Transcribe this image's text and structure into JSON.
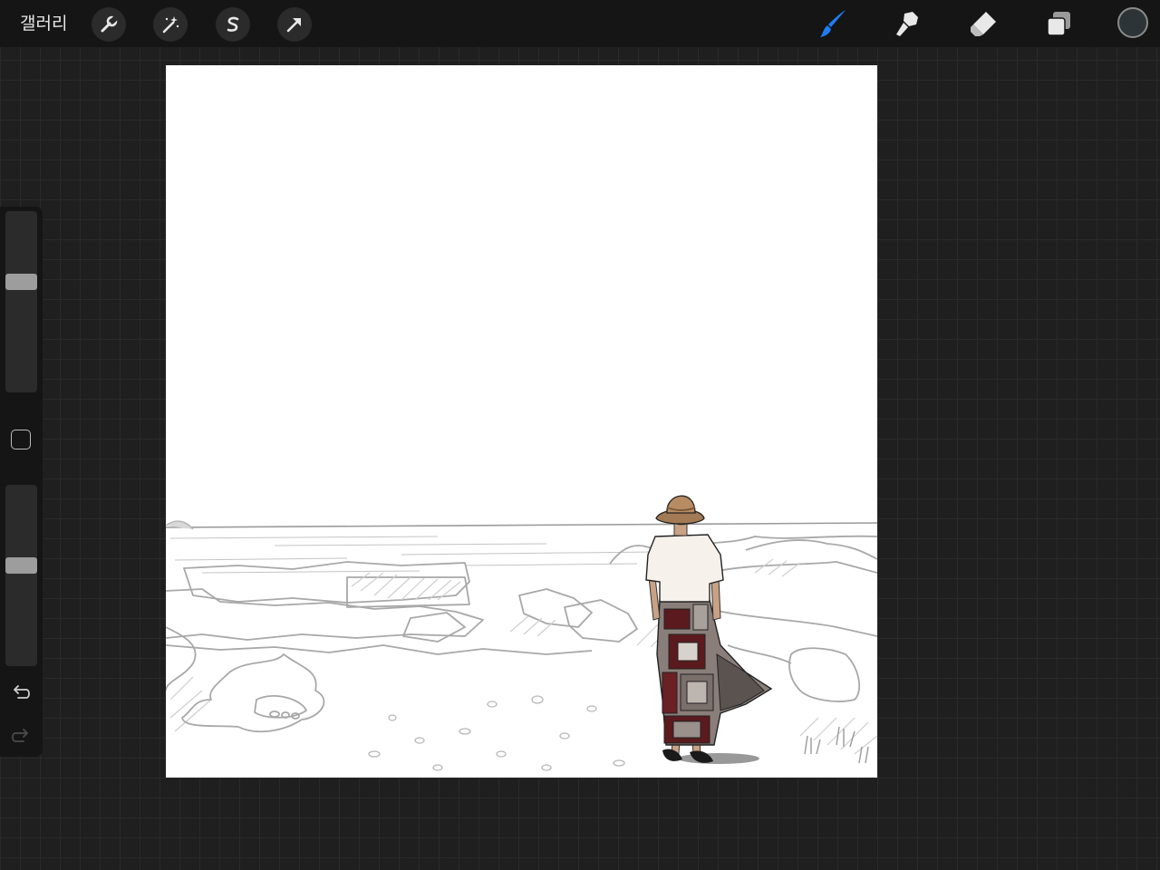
{
  "toolbar": {
    "gallery_label": "갤러리",
    "left_tools": [
      "wrench-icon",
      "magic-wand-icon",
      "selection-s-icon",
      "transform-arrow-icon"
    ],
    "right_tools": [
      "brush-icon",
      "smudge-icon",
      "eraser-icon",
      "layers-icon"
    ],
    "active_tool": "brush",
    "accent_color": "#1f7cf2",
    "current_color": "#2c3437"
  },
  "sidebar": {
    "brush_size_level": 0.62,
    "opacity_level": 0.56,
    "icons": [
      "modify-square-icon",
      "undo-icon",
      "redo-icon"
    ]
  },
  "canvas": {
    "background": "#ffffff"
  }
}
